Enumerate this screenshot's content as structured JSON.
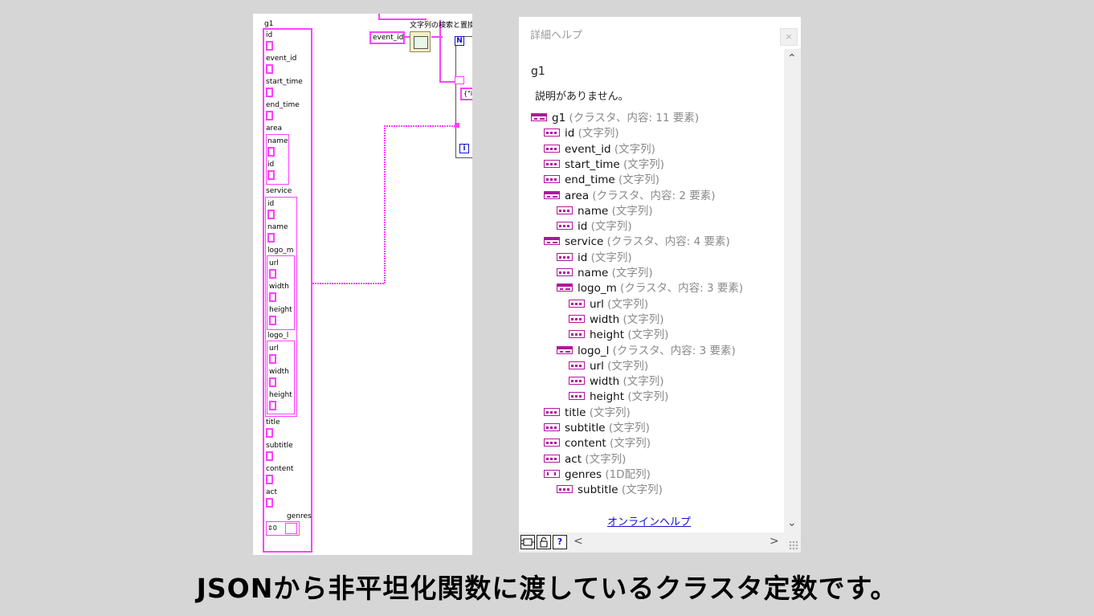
{
  "diagram": {
    "cluster_labels": {
      "g1": "g1",
      "id": "id",
      "event_id": "event_id",
      "start_time": "start_time",
      "end_time": "end_time",
      "area": "area",
      "area_name": "name",
      "area_id": "id",
      "service": "service",
      "service_id": "id",
      "service_name": "name",
      "logo_m": "logo_m",
      "logo_m_url": "url",
      "logo_m_width": "width",
      "logo_m_height": "height",
      "logo_l": "logo_l",
      "logo_l_url": "url",
      "logo_l_width": "width",
      "logo_l_height": "height",
      "title": "title",
      "subtitle": "subtitle",
      "content": "content",
      "act": "act",
      "genres": "genres",
      "array_index": "0"
    },
    "event_id_constant": "event_id",
    "search_replace_label": "文字列の検索と置換",
    "n_terminal": "N",
    "i_terminal": "i",
    "string_constant": "{\"i"
  },
  "help": {
    "title": "詳細ヘルプ",
    "close": "×",
    "name": "g1",
    "description": "説明がありません。",
    "online_help": "オンラインヘルプ",
    "tree": [
      {
        "icon": "cluster",
        "level": 0,
        "name": "g1",
        "type": "(クラスタ、内容: 11 要素)"
      },
      {
        "icon": "abc",
        "level": 1,
        "name": "id",
        "type": "(文字列)"
      },
      {
        "icon": "abc",
        "level": 1,
        "name": "event_id",
        "type": "(文字列)"
      },
      {
        "icon": "abc",
        "level": 1,
        "name": "start_time",
        "type": "(文字列)"
      },
      {
        "icon": "abc",
        "level": 1,
        "name": "end_time",
        "type": "(文字列)"
      },
      {
        "icon": "cluster",
        "level": 1,
        "name": "area",
        "type": "(クラスタ、内容: 2 要素)"
      },
      {
        "icon": "abc",
        "level": 2,
        "name": "name",
        "type": "(文字列)"
      },
      {
        "icon": "abc",
        "level": 2,
        "name": "id",
        "type": "(文字列)"
      },
      {
        "icon": "cluster",
        "level": 1,
        "name": "service",
        "type": "(クラスタ、内容: 4 要素)"
      },
      {
        "icon": "abc",
        "level": 2,
        "name": "id",
        "type": "(文字列)"
      },
      {
        "icon": "abc",
        "level": 2,
        "name": "name",
        "type": "(文字列)"
      },
      {
        "icon": "cluster",
        "level": 2,
        "name": "logo_m",
        "type": "(クラスタ、内容: 3 要素)"
      },
      {
        "icon": "abc",
        "level": 3,
        "name": "url",
        "type": "(文字列)"
      },
      {
        "icon": "abc",
        "level": 3,
        "name": "width",
        "type": "(文字列)"
      },
      {
        "icon": "abc",
        "level": 3,
        "name": "height",
        "type": "(文字列)"
      },
      {
        "icon": "cluster",
        "level": 2,
        "name": "logo_l",
        "type": "(クラスタ、内容: 3 要素)"
      },
      {
        "icon": "abc",
        "level": 3,
        "name": "url",
        "type": "(文字列)"
      },
      {
        "icon": "abc",
        "level": 3,
        "name": "width",
        "type": "(文字列)"
      },
      {
        "icon": "abc",
        "level": 3,
        "name": "height",
        "type": "(文字列)"
      },
      {
        "icon": "abc",
        "level": 1,
        "name": "title",
        "type": "(文字列)"
      },
      {
        "icon": "abc",
        "level": 1,
        "name": "subtitle",
        "type": "(文字列)"
      },
      {
        "icon": "abc",
        "level": 1,
        "name": "content",
        "type": "(文字列)"
      },
      {
        "icon": "abc",
        "level": 1,
        "name": "act",
        "type": "(文字列)"
      },
      {
        "icon": "arr",
        "level": 1,
        "name": "genres",
        "type": "(1D配列)"
      },
      {
        "icon": "abc",
        "level": 2,
        "name": "subtitle",
        "type": "(文字列)"
      }
    ],
    "bottom_buttons": [
      "lock-vi",
      "unlock",
      "?"
    ]
  },
  "caption": "JSONから非平坦化関数に渡しているクラスタ定数です。",
  "colors": {
    "wire": "#ff40ff",
    "icon": "#b0179c",
    "link": "#1010d0",
    "background": "#d6d6d6"
  }
}
